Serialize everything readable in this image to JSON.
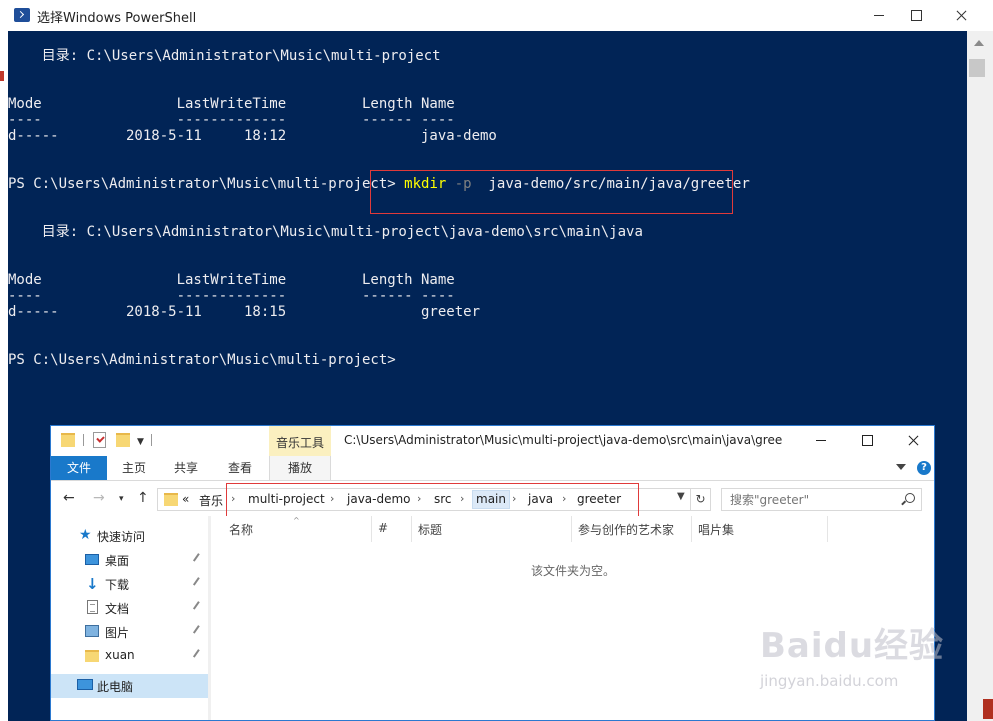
{
  "powershell": {
    "title": "选择Windows PowerShell",
    "lines": {
      "dir1": "    目录: C:\\Users\\Administrator\\Music\\multi-project",
      "hdr1": "Mode                LastWriteTime         Length Name",
      "sep1": "----                -------------         ------ ----",
      "row1": "d-----        2018-5-11     18:12                java-demo",
      "prompt1": "PS C:\\Users\\Administrator\\Music\\multi-project> ",
      "cmd_name": "mkdir",
      "cmd_flag": " -p ",
      "cmd_arg": " java-demo/src/main/java/greeter",
      "dir2": "    目录: C:\\Users\\Administrator\\Music\\multi-project\\java-demo\\src\\main\\java",
      "hdr2": "Mode                LastWriteTime         Length Name",
      "sep2": "----                -------------         ------ ----",
      "row2": "d-----        2018-5-11     18:15                greeter",
      "prompt2": "PS C:\\Users\\Administrator\\Music\\multi-project>"
    }
  },
  "explorer": {
    "contextual_tab": "音乐工具",
    "title_path": "C:\\Users\\Administrator\\Music\\multi-project\\java-demo\\src\\main\\java\\gree",
    "ribbon_tabs": [
      "文件",
      "主页",
      "共享",
      "查看",
      "播放"
    ],
    "help_label": "?",
    "breadcrumb": {
      "overflow": "«",
      "items": [
        "音乐",
        "multi-project",
        "java-demo",
        "src",
        "main",
        "java",
        "greeter"
      ]
    },
    "search_placeholder": "搜索\"greeter\"",
    "nav_items": [
      {
        "label": "快速访问",
        "icon": "star-icon"
      },
      {
        "label": "桌面",
        "icon": "desktop-icon"
      },
      {
        "label": "下载",
        "icon": "download-icon"
      },
      {
        "label": "文档",
        "icon": "document-icon"
      },
      {
        "label": "图片",
        "icon": "pictures-icon"
      },
      {
        "label": "xuan",
        "icon": "folder-icon"
      },
      {
        "label": "此电脑",
        "icon": "computer-icon"
      }
    ],
    "columns": [
      "名称",
      "#",
      "标题",
      "参与创作的艺术家",
      "唱片集"
    ],
    "empty_message": "该文件夹为空。"
  },
  "watermark": {
    "brand": "Baidu经验",
    "url": "jingyan.baidu.com"
  },
  "colors": {
    "console_bg": "#012456",
    "console_text": "#eeedf0",
    "command_yellow": "#ffff00",
    "highlight_red": "#e03a3a",
    "accent_blue": "#1979ca"
  }
}
